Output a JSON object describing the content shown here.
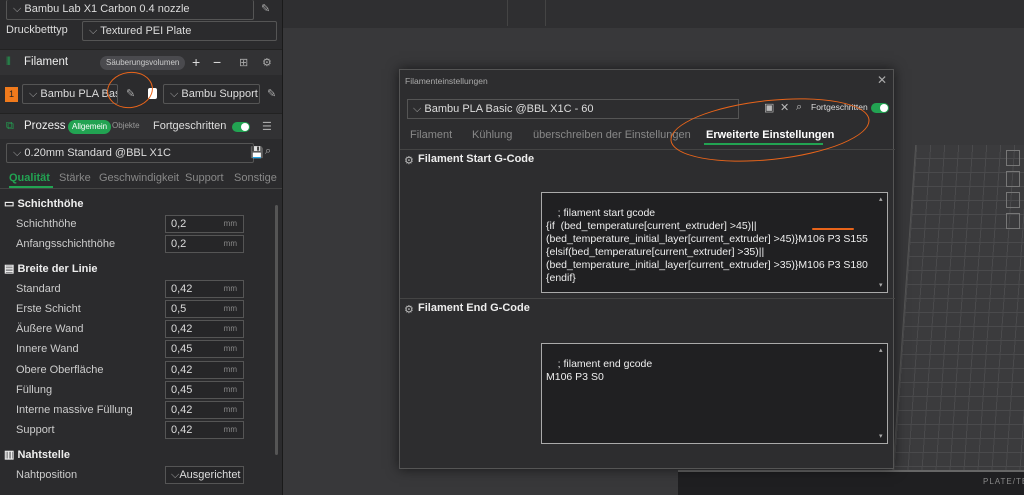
{
  "printer": {
    "name": "Bambu Lab X1 Carbon 0.4 nozzle"
  },
  "plate": {
    "label": "Druckbetttyp",
    "value": "Textured PEI Plate"
  },
  "filament": {
    "title": "Filament",
    "purge_label": "Säuberungsvolumen",
    "slot_number": "1",
    "preset1": "Bambu PLA Basic",
    "preset2": "Bambu Support W"
  },
  "process": {
    "title": "Prozess",
    "tab_global": "Allgemein",
    "tab_objects": "Objekte",
    "advanced_label": "Fortgeschritten",
    "preset": "0.20mm Standard @BBL X1C",
    "tabs": [
      "Qualität",
      "Stärke",
      "Geschwindigkeit",
      "Support",
      "Sonstige"
    ]
  },
  "groups": {
    "layer_height": {
      "title": "Schichthöhe",
      "params": [
        {
          "label": "Schichthöhe",
          "value": "0,2",
          "unit": "mm"
        },
        {
          "label": "Anfangsschichthöhe",
          "value": "0,2",
          "unit": "mm"
        }
      ]
    },
    "line_width": {
      "title": "Breite der Linie",
      "params": [
        {
          "label": "Standard",
          "value": "0,42",
          "unit": "mm"
        },
        {
          "label": "Erste Schicht",
          "value": "0,5",
          "unit": "mm"
        },
        {
          "label": "Äußere Wand",
          "value": "0,42",
          "unit": "mm"
        },
        {
          "label": "Innere Wand",
          "value": "0,45",
          "unit": "mm"
        },
        {
          "label": "Obere Oberfläche",
          "value": "0,42",
          "unit": "mm"
        },
        {
          "label": "Füllung",
          "value": "0,45",
          "unit": "mm"
        },
        {
          "label": "Interne massive Füllung",
          "value": "0,42",
          "unit": "mm"
        },
        {
          "label": "Support",
          "value": "0,42",
          "unit": "mm"
        }
      ]
    },
    "seam": {
      "title": "Nahtstelle",
      "params": [
        {
          "label": "Nahtposition",
          "value": "Ausgerichtet"
        }
      ]
    }
  },
  "dialog": {
    "title": "Filamenteinstellungen",
    "preset": "Bambu PLA Basic @BBL X1C - 60",
    "advanced_label": "Fortgeschritten",
    "tabs": [
      "Filament",
      "Kühlung",
      "überschreiben der Einstellungen",
      "Erweiterte Einstellungen"
    ],
    "start_gcode_title": "Filament Start G-Code",
    "start_gcode": "; filament start gcode\n{if  (bed_temperature[current_extruder] >45)||\n(bed_temperature_initial_layer[current_extruder] >45)}M106 P3 S155\n{elsif(bed_temperature[current_extruder] >35)||\n(bed_temperature_initial_layer[current_extruder] >35)}M106 P3 S180\n{endif}",
    "end_gcode_title": "Filament End G-Code",
    "end_gcode": "; filament end gcode\nM106 P3 S0"
  },
  "viewport": {
    "bed_label": "PLATE/TEX/PEI"
  },
  "colors": {
    "accent": "#22a352",
    "annotation": "#e8641a",
    "slot": "#f07a1c"
  }
}
